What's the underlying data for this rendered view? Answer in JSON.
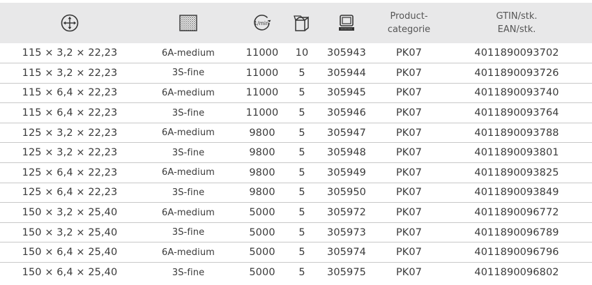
{
  "header": {
    "col_dimensions_icon": "move-arrows-circle-icon",
    "col_grit_icon": "abrasive-texture-icon",
    "col_speed_icon": "rpm-gauge-icon",
    "col_pack_icon": "package-box-icon",
    "col_article_icon": "computer-terminal-icon",
    "col_category_line1": "Product-",
    "col_category_line2": "categorie",
    "col_gtin_line1": "GTIN/stk.",
    "col_gtin_line2": "EAN/stk.",
    "speed_icon_text": "1/min"
  },
  "rows": [
    {
      "size": "115 × 3,2 × 22,23",
      "grit": "6A-medium",
      "rpm": "11000",
      "pack": "10",
      "article": "305943",
      "category": "PK07",
      "gtin": "4011890093702"
    },
    {
      "size": "115 × 3,2 × 22,23",
      "grit": "3S-fine",
      "rpm": "11000",
      "pack": "5",
      "article": "305944",
      "category": "PK07",
      "gtin": "4011890093726"
    },
    {
      "size": "115 × 6,4 × 22,23",
      "grit": "6A-medium",
      "rpm": "11000",
      "pack": "5",
      "article": "305945",
      "category": "PK07",
      "gtin": "4011890093740"
    },
    {
      "size": "115 × 6,4 × 22,23",
      "grit": "3S-fine",
      "rpm": "11000",
      "pack": "5",
      "article": "305946",
      "category": "PK07",
      "gtin": "4011890093764"
    },
    {
      "size": "125 × 3,2 × 22,23",
      "grit": "6A-medium",
      "rpm": "9800",
      "pack": "5",
      "article": "305947",
      "category": "PK07",
      "gtin": "4011890093788"
    },
    {
      "size": "125 × 3,2 × 22,23",
      "grit": "3S-fine",
      "rpm": "9800",
      "pack": "5",
      "article": "305948",
      "category": "PK07",
      "gtin": "4011890093801"
    },
    {
      "size": "125 × 6,4 × 22,23",
      "grit": "6A-medium",
      "rpm": "9800",
      "pack": "5",
      "article": "305949",
      "category": "PK07",
      "gtin": "4011890093825"
    },
    {
      "size": "125 × 6,4 × 22,23",
      "grit": "3S-fine",
      "rpm": "9800",
      "pack": "5",
      "article": "305950",
      "category": "PK07",
      "gtin": "4011890093849"
    },
    {
      "size": "150 × 3,2 × 25,40",
      "grit": "6A-medium",
      "rpm": "5000",
      "pack": "5",
      "article": "305972",
      "category": "PK07",
      "gtin": "4011890096772"
    },
    {
      "size": "150 × 3,2 × 25,40",
      "grit": "3S-fine",
      "rpm": "5000",
      "pack": "5",
      "article": "305973",
      "category": "PK07",
      "gtin": "4011890096789"
    },
    {
      "size": "150 × 6,4 × 25,40",
      "grit": "6A-medium",
      "rpm": "5000",
      "pack": "5",
      "article": "305974",
      "category": "PK07",
      "gtin": "4011890096796"
    },
    {
      "size": "150 × 6,4 × 25,40",
      "grit": "3S-fine",
      "rpm": "5000",
      "pack": "5",
      "article": "305975",
      "category": "PK07",
      "gtin": "4011890096802"
    }
  ]
}
